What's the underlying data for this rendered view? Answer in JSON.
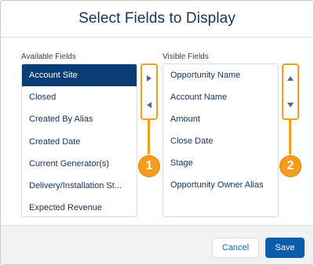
{
  "modal": {
    "title": "Select Fields to Display"
  },
  "available": {
    "label": "Available Fields",
    "items": [
      "Account Site",
      "Closed",
      "Created By Alias",
      "Created Date",
      "Current Generator(s)",
      "Delivery/Installation St...",
      "Expected Revenue"
    ],
    "selected": "Account Site"
  },
  "visible": {
    "label": "Visible Fields",
    "items": [
      "Opportunity Name",
      "Account Name",
      "Amount",
      "Close Date",
      "Stage",
      "Opportunity Owner Alias"
    ]
  },
  "callouts": {
    "one": "1",
    "two": "2"
  },
  "footer": {
    "cancel_label": "Cancel",
    "save_label": "Save"
  },
  "colors": {
    "selected_bg": "#0b3d75",
    "callout": "#f59c1a",
    "save_bg": "#0b5cab",
    "link": "#0070d2"
  },
  "icons": {
    "move_right": "chevron-right-icon",
    "move_left": "chevron-left-icon",
    "move_up": "chevron-up-icon",
    "move_down": "chevron-down-icon"
  }
}
